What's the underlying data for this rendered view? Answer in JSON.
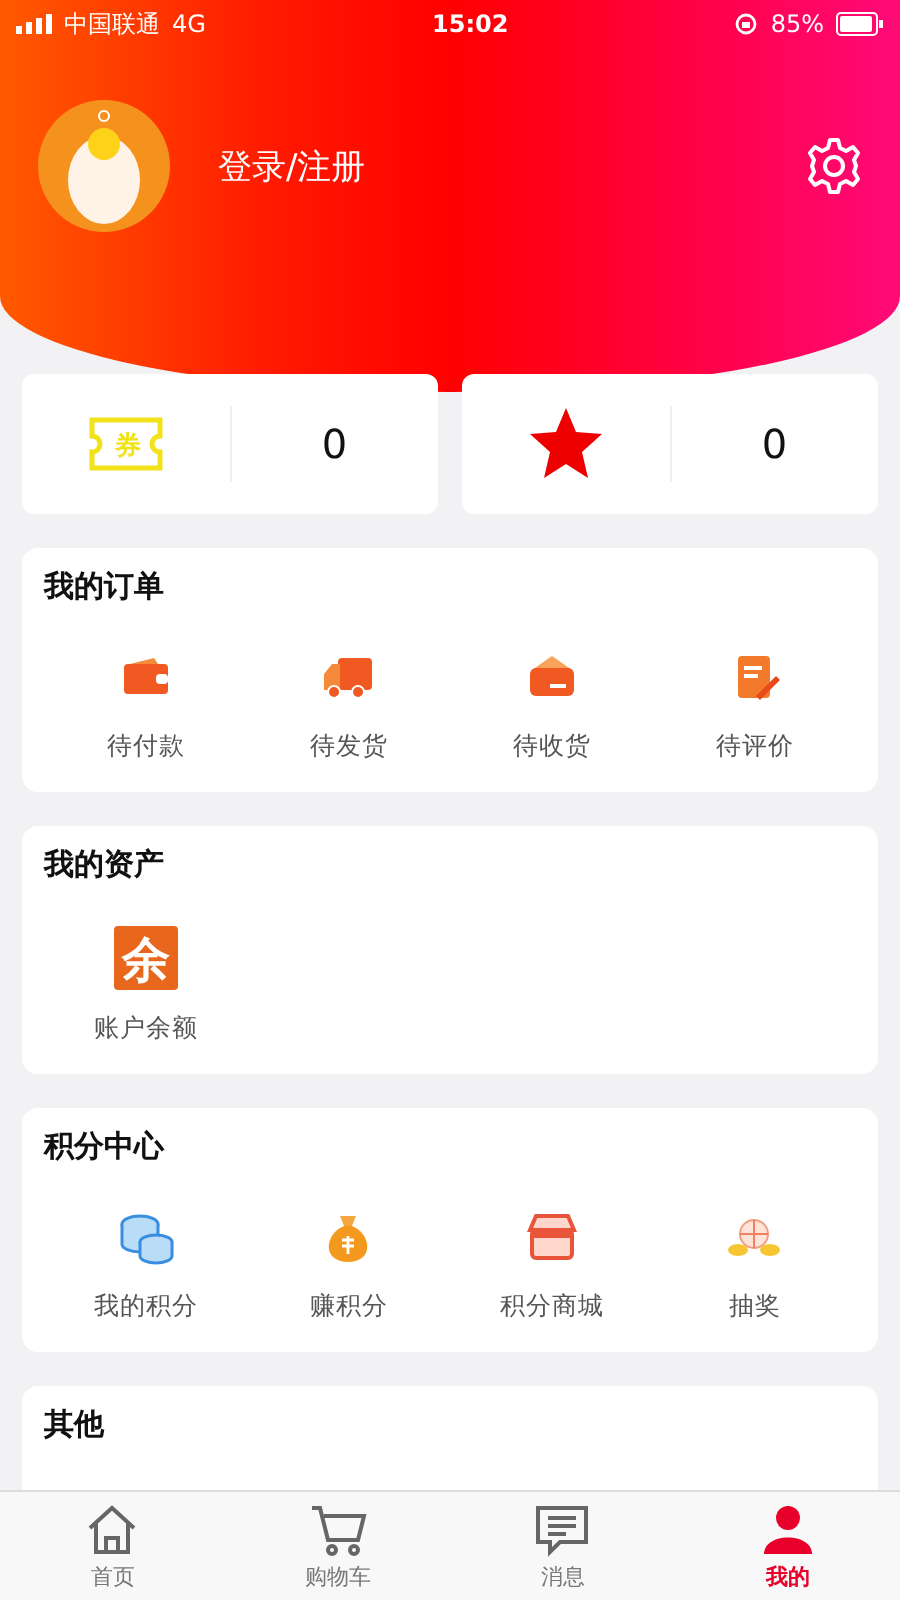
{
  "status_bar": {
    "carrier": "中国联通",
    "network": "4G",
    "time": "15:02",
    "battery": "85%"
  },
  "profile": {
    "login": "登录/注册"
  },
  "stats": [
    {
      "kind": "coupon",
      "glyph": "券",
      "value": "0"
    },
    {
      "kind": "favorite",
      "value": "0"
    }
  ],
  "sections": [
    {
      "title": "我的订单",
      "items": [
        {
          "kind": "wallet",
          "label": "待付款"
        },
        {
          "kind": "truck",
          "label": "待发货"
        },
        {
          "kind": "box",
          "label": "待收货"
        },
        {
          "kind": "note",
          "label": "待评价"
        }
      ]
    },
    {
      "title": "我的资产",
      "items": [
        {
          "kind": "balance",
          "glyph": "余",
          "label": "账户余额"
        }
      ]
    },
    {
      "title": "积分中心",
      "items": [
        {
          "kind": "coins",
          "label": "我的积分"
        },
        {
          "kind": "moneybag",
          "label": "赚积分"
        },
        {
          "kind": "store",
          "label": "积分商城"
        },
        {
          "kind": "lottery",
          "label": "抽奖"
        }
      ]
    },
    {
      "title": "其他"
    }
  ],
  "tabs": [
    {
      "kind": "home",
      "label": "首页",
      "selected": false
    },
    {
      "kind": "cart",
      "label": "购物车",
      "selected": false
    },
    {
      "kind": "message",
      "label": "消息",
      "selected": false
    },
    {
      "kind": "user",
      "label": "我的",
      "selected": true
    }
  ]
}
